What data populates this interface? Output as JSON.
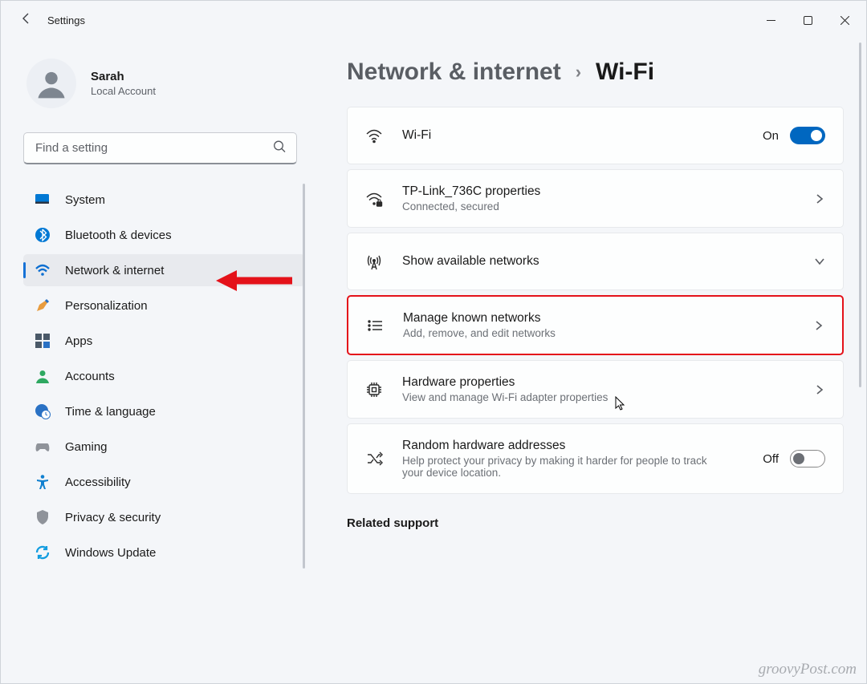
{
  "window": {
    "title": "Settings"
  },
  "user": {
    "name": "Sarah",
    "account": "Local Account"
  },
  "search": {
    "placeholder": "Find a setting"
  },
  "nav": {
    "items": [
      {
        "label": "System"
      },
      {
        "label": "Bluetooth & devices"
      },
      {
        "label": "Network & internet"
      },
      {
        "label": "Personalization"
      },
      {
        "label": "Apps"
      },
      {
        "label": "Accounts"
      },
      {
        "label": "Time & language"
      },
      {
        "label": "Gaming"
      },
      {
        "label": "Accessibility"
      },
      {
        "label": "Privacy & security"
      },
      {
        "label": "Windows Update"
      }
    ],
    "selected_index": 2
  },
  "breadcrumb": {
    "parent": "Network & internet",
    "current": "Wi-Fi"
  },
  "cards": {
    "wifi": {
      "title": "Wi-Fi",
      "state_label": "On",
      "state": true
    },
    "connected": {
      "title": "TP-Link_736C properties",
      "subtitle": "Connected, secured"
    },
    "available": {
      "title": "Show available networks"
    },
    "known": {
      "title": "Manage known networks",
      "subtitle": "Add, remove, and edit networks"
    },
    "hardware": {
      "title": "Hardware properties",
      "subtitle": "View and manage Wi-Fi adapter properties"
    },
    "random": {
      "title": "Random hardware addresses",
      "subtitle": "Help protect your privacy by making it harder for people to track your device location.",
      "state_label": "Off",
      "state": false
    }
  },
  "related": {
    "heading": "Related support"
  },
  "watermark": "groovyPost.com"
}
